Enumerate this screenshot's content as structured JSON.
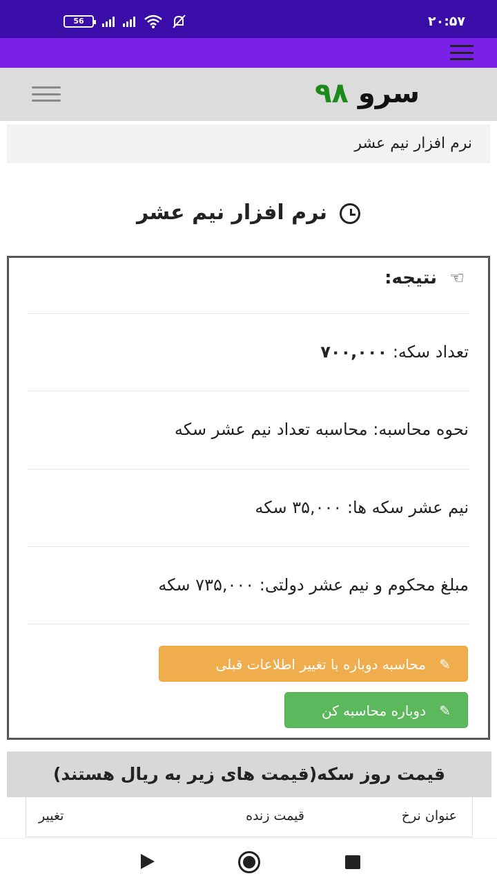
{
  "status_bar": {
    "time": "۲۰:۵۷",
    "battery": "56"
  },
  "site": {
    "logo_word": "سرو",
    "logo_number": "۹۸"
  },
  "breadcrumb": "نرم افزار نیم عشر",
  "page_title": "نرم افزار نیم عشر",
  "result": {
    "heading": "نتیجه:",
    "rows": [
      {
        "label": "تعداد سکه:",
        "value": "۷۰۰,۰۰۰"
      },
      {
        "label": "نحوه محاسبه:",
        "value": "محاسبه تعداد نیم عشر سکه"
      },
      {
        "label": "نیم عشر سکه ها:",
        "value": "۳۵,۰۰۰ سکه"
      },
      {
        "label": "مبلغ محکوم و نیم عشر دولتی:",
        "value": "۷۳۵,۰۰۰ سکه"
      }
    ],
    "recalc_with_change": "محاسبه دوباره با تغییر اطلاعات قبلی",
    "recalc": "دوباره محاسبه کن"
  },
  "price_panel": {
    "title": "قیمت روز سکه(قیمت های زیر به ریال هستند)",
    "columns": [
      "عنوان نرخ",
      "قیمت زنده",
      "تغییر"
    ]
  },
  "colors": {
    "status_bar": "#3a0ca8",
    "app_bar": "#7a1fe6",
    "warning": "#f0ad4e",
    "success": "#5cb85c"
  }
}
